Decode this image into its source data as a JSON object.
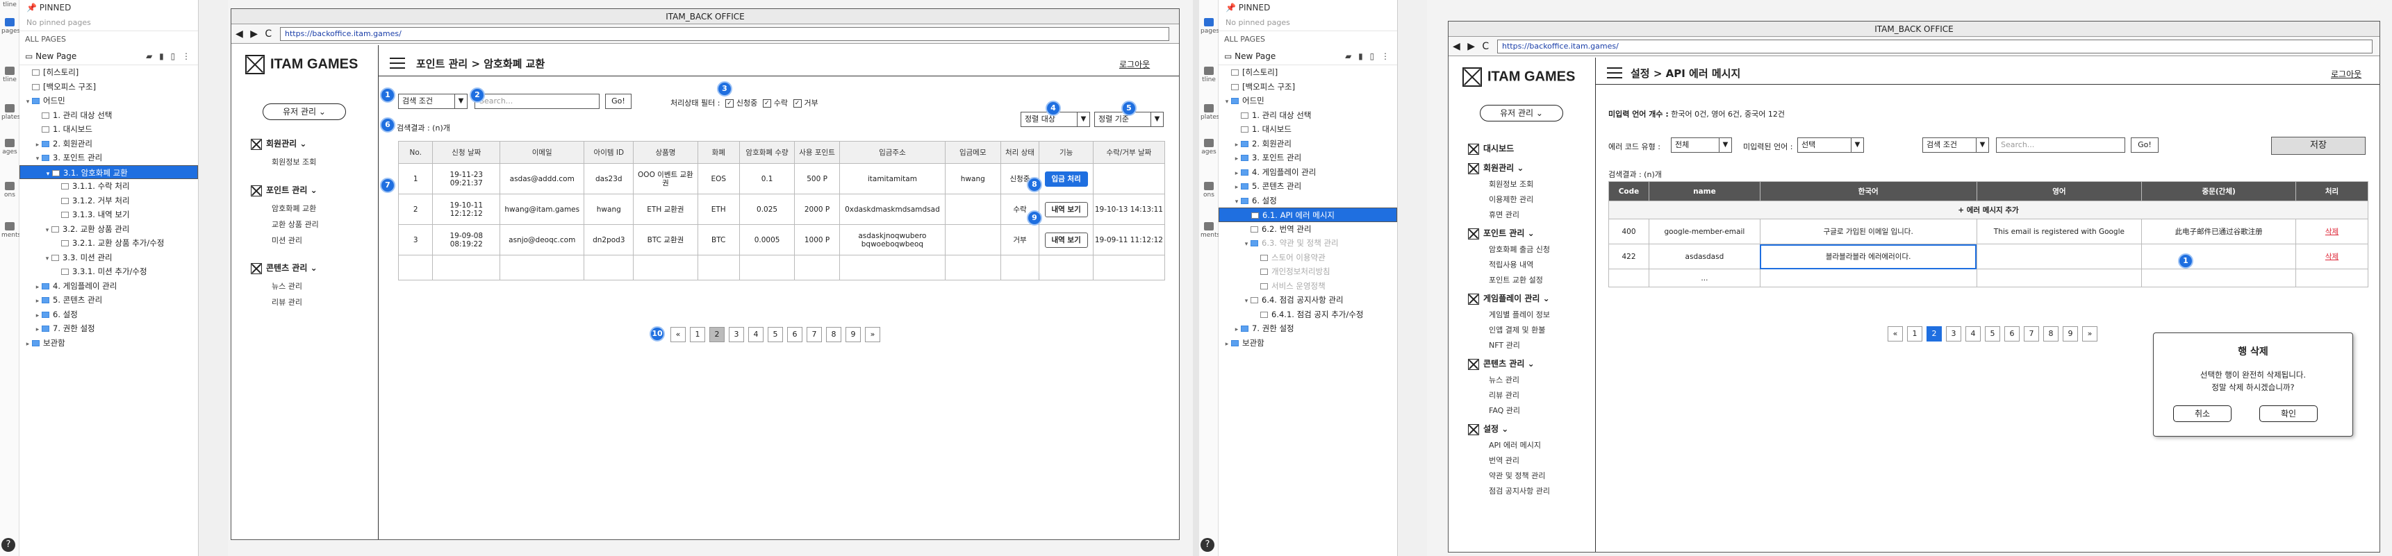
{
  "outline": {
    "pinned_label": "PINNED",
    "no_pinned": "No pinned pages",
    "all_pages": "ALL PAGES",
    "new_page": "New Page",
    "tools": "▰ ▮ ▯ ⋮",
    "rail_labels": [
      "tline",
      "pages",
      "tline",
      "plates",
      "ages",
      "ons",
      "ments"
    ],
    "tree": [
      "[히스토리]",
      "[백오피스 구조]",
      "어드민",
      "1. 관리 대상 선택",
      "1. 대시보드",
      "2. 회원관리",
      "3. 포인트 관리",
      "3.1. 암호화폐 교환",
      "3.1.1. 수락 처리",
      "3.1.2. 거부 처리",
      "3.1.3. 내역 보기",
      "3.2. 교환 상품 관리",
      "3.2.1. 교환 상품 추가/수정",
      "3.3. 미션 관리",
      "3.3.1. 미션 추가/수정",
      "4. 게임플레이 관리",
      "5. 콘텐츠 관리",
      "6. 설정",
      "7. 권한 설정",
      "보관함"
    ],
    "tree_right": [
      "[히스토리]",
      "[백오피스 구조]",
      "어드민",
      "1. 관리 대상 선택",
      "1. 대시보드",
      "2. 회원관리",
      "3. 포인트 관리",
      "4. 게임플레이 관리",
      "5. 콘텐츠 관리",
      "6. 설정",
      "6.1. API 에러 메시지",
      "6.2. 번역 관리",
      "6.3. 약관 및 정책 관리",
      "스토어 이용약관",
      "개인정보처리방침",
      "서비스 운영정책",
      "6.4. 점검 공지사항 관리",
      "6.4.1. 점검 공지 추가/수정",
      "7. 권한 설정",
      "보관함"
    ]
  },
  "browser": {
    "title": "ITAM_BACK OFFICE",
    "nav": "◀ ▶ C",
    "url": "https://backoffice.itam.games/"
  },
  "app": {
    "logo": "ITAM GAMES",
    "user_menu": "유저 관리",
    "logout": "로그아웃",
    "menu": {
      "members": "회원관리",
      "members_sub": [
        "회원정보 조회"
      ],
      "points": "포인트 관리",
      "points_sub": [
        "암호화폐 교환",
        "교환 상품 관리",
        "미션 관리"
      ],
      "contents": "콘텐츠 관리",
      "contents_sub": [
        "뉴스 관리",
        "리뷰 관리"
      ]
    },
    "menu_right": {
      "dashboard": "대시보드",
      "members": "회원관리",
      "members_sub": [
        "회원정보 조회",
        "이용제한 관리",
        "휴면 관리"
      ],
      "points": "포인트 관리",
      "points_sub": [
        "암호화폐 출금 신청",
        "적립사용 내역",
        "포인트 교환 설정"
      ],
      "gameplay": "게임플레이 관리",
      "gameplay_sub": [
        "게임별 플레이 정보",
        "인앱 결제 및 환불",
        "NFT 관리"
      ],
      "contents": "콘텐츠 관리",
      "contents_sub": [
        "뉴스 관리",
        "리뷰 관리",
        "FAQ 관리"
      ],
      "settings": "설정",
      "settings_sub": [
        "API 에러 메시지",
        "번역 관리",
        "약관 및 정책 관리",
        "점검 공지사항 관리"
      ]
    }
  },
  "left_page": {
    "breadcrumb": "포인트 관리 > 암호화폐 교환",
    "search_condition": "검색 조건",
    "search_placeholder": "Search...",
    "go": "Go!",
    "status_filter": "처리상태 필터 :",
    "filters": [
      "신청중",
      "수락",
      "거부"
    ],
    "sort_target": "정렬 대상",
    "sort_basis": "정렬 기준",
    "result_count": "검색결과 : (n)개",
    "headers": [
      "No.",
      "신청 날짜",
      "이메일",
      "아이템 ID",
      "상품명",
      "화폐",
      "암호화폐 수량",
      "사용 포인트",
      "입금주소",
      "입금메모",
      "처리 상태",
      "기능",
      "수락/거부 날짜"
    ],
    "rows": [
      [
        "1",
        "19-11-23 09:21:37",
        "asdas@addd.com",
        "das23d",
        "OOO 이벤트 교환권",
        "EOS",
        "0.1",
        "500 P",
        "itamitamitam",
        "hwang",
        "신청중",
        "입금 처리",
        ""
      ],
      [
        "2",
        "19-10-11 12:12:12",
        "hwang@itam.games",
        "hwang",
        "ETH 교환권",
        "ETH",
        "0.025",
        "2000 P",
        "0xdaskdmaskmdsamdsad",
        "",
        "수락",
        "내역 보기",
        "19-10-13 14:13:11"
      ],
      [
        "3",
        "19-09-08 08:19:22",
        "asnjo@deoqc.com",
        "dn2pod3",
        "BTC 교환권",
        "BTC",
        "0.0005",
        "1000 P",
        "asdaskjnoqwubero bqwoeboqwbeoq",
        "",
        "거부",
        "내역 보기",
        "19-09-11 11:12:12"
      ]
    ],
    "pages": [
      "«",
      "1",
      "2",
      "3",
      "4",
      "5",
      "6",
      "7",
      "8",
      "9",
      "»"
    ],
    "active_page": "2",
    "badges": [
      "1",
      "2",
      "3",
      "4",
      "5",
      "6",
      "7",
      "8",
      "9",
      "10"
    ]
  },
  "right_page": {
    "breadcrumb": "설정 > API 에러 메시지",
    "untranslated_label": "미입력 언어 개수 :",
    "untranslated_value": "한국어 0건, 영어 6건, 중국어 12건",
    "code_type_label": "에러 코드 유형 :",
    "code_type_value": "전체",
    "missing_lang_label": "미입력된 언어 :",
    "missing_lang_value": "선택",
    "search_condition": "검색 조건",
    "search_placeholder": "Search...",
    "go": "Go!",
    "save": "저장",
    "result_count": "검색결과 : (n)개",
    "headers": [
      "Code",
      "name",
      "한국어",
      "영어",
      "중문(간체)",
      "처리"
    ],
    "add_row": "+ 에러 메시지 추가",
    "rows": [
      [
        "400",
        "google-member-email",
        "구글로 가입된 이메일 입니다.",
        "This email is registered with Google",
        "此电子邮件已通过谷歌注册",
        "삭제"
      ],
      [
        "422",
        "asdasdasd",
        "블라블라블라 에러에러이다.",
        "",
        "",
        "삭제"
      ]
    ],
    "ellipsis": "...",
    "pages": [
      "«",
      "1",
      "2",
      "3",
      "4",
      "5",
      "6",
      "7",
      "8",
      "9",
      "»"
    ],
    "active_page": "2",
    "badge": "1",
    "modal": {
      "title": "행 삭제",
      "line1": "선택한 행이 완전히 삭제됩니다.",
      "line2": "정말 삭제 하시겠습니까?",
      "cancel": "취소",
      "confirm": "확인"
    }
  },
  "colors": {
    "accent": "#1f6fe0",
    "delete": "#d22233"
  }
}
